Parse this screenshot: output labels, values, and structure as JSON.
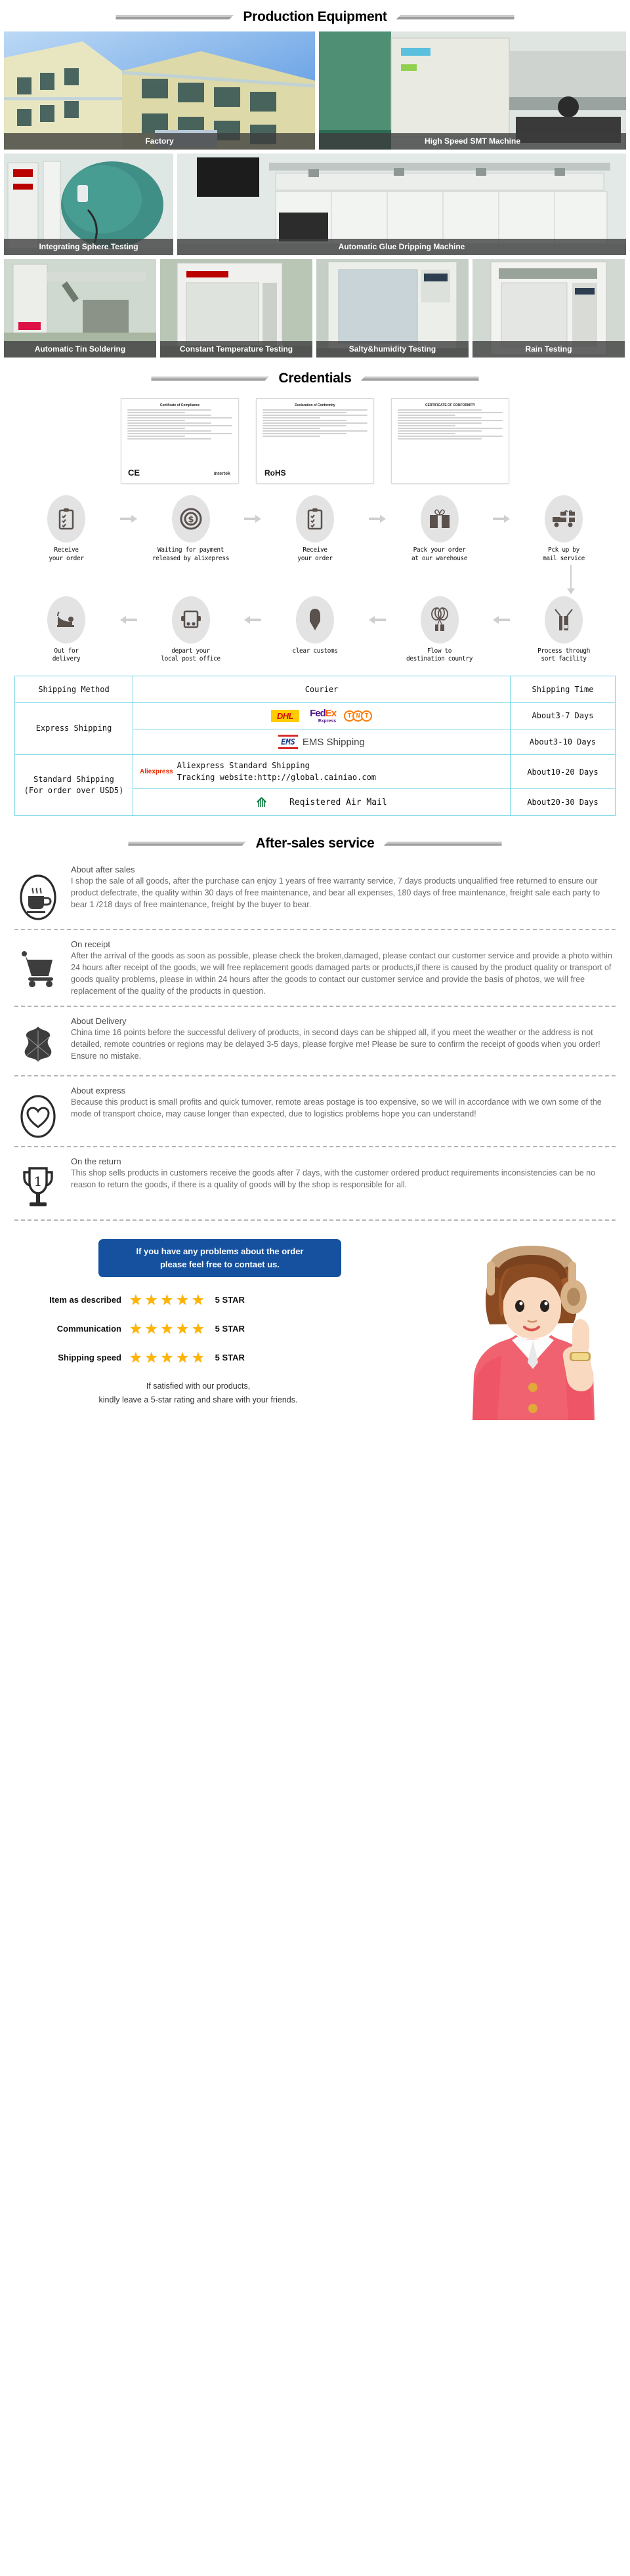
{
  "sections": {
    "production": "Production Equipment",
    "credentials": "Credentials",
    "aftersales": "After-sales service"
  },
  "equipment": {
    "row1": [
      {
        "caption": "Factory",
        "icon": "factory-photo"
      },
      {
        "caption": "High Speed SMT Machine",
        "icon": "smt-machine-photo"
      }
    ],
    "row2": [
      {
        "caption": "Integrating Sphere Testing",
        "icon": "integrating-sphere-photo"
      },
      {
        "caption": "Automatic Glue Dripping Machine",
        "icon": "glue-dripping-photo"
      }
    ],
    "row3": [
      {
        "caption": "Automatic Tin Soldering",
        "icon": "tin-soldering-photo"
      },
      {
        "caption": "Constant Temperature Testing",
        "icon": "constant-temperature-photo"
      },
      {
        "caption": "Salty&humidity Testing",
        "icon": "salty-humidity-photo"
      },
      {
        "caption": "Rain Testing",
        "icon": "rain-testing-photo"
      }
    ]
  },
  "certificates": [
    {
      "title": "Certificate of Compliance",
      "mark": "CE",
      "mark2": "Intertek"
    },
    {
      "title": "Declaration of Conformity",
      "mark": "RoHS",
      "mark2": ""
    },
    {
      "title": "CERTIFICATE OF CONFORMITY",
      "mark": "",
      "mark2": ""
    }
  ],
  "process": {
    "row1": [
      {
        "icon": "clipboard-icon",
        "line1": "Receive",
        "line2": "your order"
      },
      {
        "icon": "dollar-coin-icon",
        "line1": "Waiting for payment",
        "line2": "released by alixepress"
      },
      {
        "icon": "clipboard-icon",
        "line1": "Receive",
        "line2": "your order"
      },
      {
        "icon": "gift-box-icon",
        "line1": "Pack your order",
        "line2": "at our warehouse"
      },
      {
        "icon": "delivery-truck-icon",
        "line1": "Pck up by",
        "line2": "mail service"
      }
    ],
    "row2": [
      {
        "icon": "high-heel-shoe-icon",
        "line1": "Out for",
        "line2": "delivery"
      },
      {
        "icon": "post-van-icon",
        "line1": "depart your",
        "line2": "local post office"
      },
      {
        "icon": "customs-icon",
        "line1": "clear customs",
        "line2": ""
      },
      {
        "icon": "balloon-gift-icon",
        "line1": "Flow to",
        "line2": "destination country"
      },
      {
        "icon": "mail-sort-icon",
        "line1": "Process through",
        "line2": "sort facility"
      }
    ]
  },
  "shipping_table": {
    "headers": [
      "Shipping Method",
      "Courier",
      "Shipping Time"
    ],
    "groups": [
      {
        "method": "Express Shipping",
        "rows": [
          {
            "courier_type": "logos",
            "couriers": [
              "DHL",
              "FedEx Express",
              "TNT"
            ],
            "time": "About3-7 Days"
          },
          {
            "courier_type": "ems",
            "couriers": [
              "EMS Shipping"
            ],
            "time": "About3-10 Days"
          }
        ]
      },
      {
        "method": "Standard Shipping\n(For order over USD5)",
        "rows": [
          {
            "courier_type": "ali",
            "couriers": [
              "Aliexpress Standard Shipping",
              "Tracking website:http://global.cainiao.com"
            ],
            "time": "About10-20 Days"
          },
          {
            "courier_type": "air",
            "couriers": [
              "Reqistered Air Mail"
            ],
            "time": "About20-30 Days"
          }
        ]
      }
    ]
  },
  "aftersales_items": [
    {
      "icon": "coffee-cup-icon",
      "title": "About after sales",
      "body": " I shop the sale of all goods, after the purchase can enjoy 1 years of free warranty service, 7 days products unqualified free returned to ensure our product defectrate, the quality within 30 days of free maintenance, and bear all expenses, 180 days of free maintenance, freight sale each party to bear 1 /218 days of free maintenance, freight by the buyer to bear."
    },
    {
      "icon": "shopping-cart-icon",
      "title": "On receipt",
      "body": "After the arrival of the goods as soon as possible, please check the broken,damaged, please contact our customer service and provide a photo within 24 hours after receipt of the goods, we will free replacement goods damaged parts or products,if there is caused by the product quality or transport of goods quality problems, please in within 24 hours after the goods to contact our customer service and provide the basis of photos, we will free replacement of the quality of the products in question."
    },
    {
      "icon": "leather-hide-icon",
      "title": "About Delivery",
      "body": " China time 16 points before the successful delivery of products, in second days can be shipped all, if you meet the weather or the address is not detailed, remote countries or regions may be delayed 3-5 days, please forgive me! Please be sure to confirm the receipt of goods when you order! Ensure no mistake."
    },
    {
      "icon": "heart-icon",
      "title": "About express",
      "body": "Because this product is small profits and quick turnover, remote areas postage is too expensive, so we will in accordance with we own some of the mode of transport choice, may cause longer than expected, due to logistics problems hope you can understand!"
    },
    {
      "icon": "trophy-icon",
      "title": "On the return",
      "body": "This shop sells products in customers receive the goods after 7 days, with the customer ordered product requirements inconsistencies can be no reason to return the goods, if there is a quality of goods will by the shop is responsible for all."
    }
  ],
  "footer": {
    "contact_line1": "If you have any problems about the order",
    "contact_line2": "please feel free to contaet us.",
    "ratings": [
      {
        "name": "Item as described",
        "stars": 5,
        "value": "5 STAR"
      },
      {
        "name": "Communication",
        "stars": 5,
        "value": "5 STAR"
      },
      {
        "name": "Shipping speed",
        "stars": 5,
        "value": "5 STAR"
      }
    ],
    "closing_line1": "If satisfied with our products,",
    "closing_line2": "kindly leave a 5-star rating and share with your friends.",
    "agent_icon": "support-agent-illustration",
    "star_color": "#ffb400",
    "pill_color": "#15519e",
    "table_border_color": "#6fd3e8",
    "ship_label_color": "#f3a712"
  }
}
